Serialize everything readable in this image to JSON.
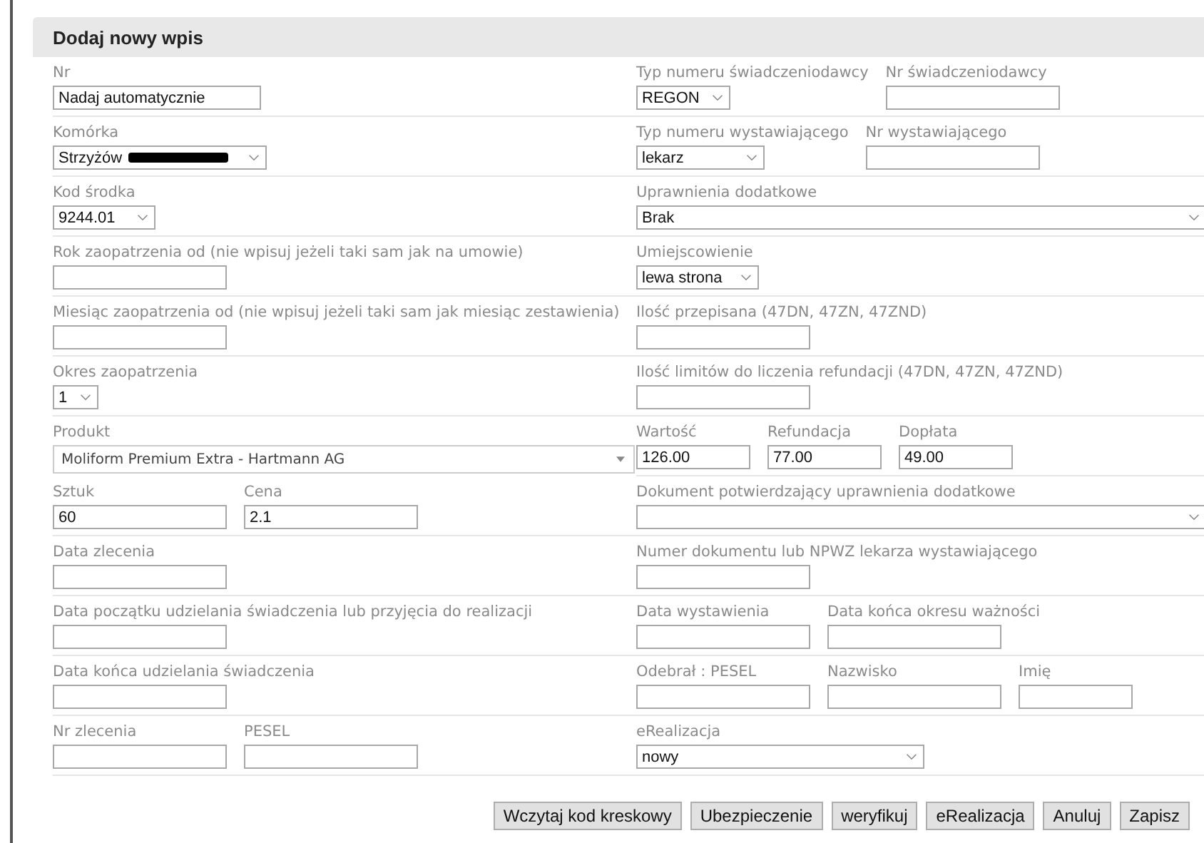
{
  "dialog": {
    "title": "Dodaj nowy wpis"
  },
  "rows": [
    {
      "left": {
        "divider": true,
        "fields": [
          {
            "label": "Nr",
            "kind": "text",
            "value": "Nadaj automatycznie"
          }
        ]
      },
      "right": {
        "divider": true,
        "fields": [
          {
            "label": "Typ numeru świadczeniodawcy",
            "kind": "select",
            "value": "REGON"
          },
          {
            "label": "Nr świadczeniodawcy",
            "kind": "text"
          }
        ]
      }
    },
    {
      "left": {
        "divider": true,
        "fields": [
          {
            "label": "Komórka",
            "kind": "select",
            "value": "Strzyżów",
            "redacted": true
          }
        ]
      },
      "right": {
        "divider": true,
        "fields": [
          {
            "label": "Typ numeru wystawiającego",
            "kind": "select",
            "value": "lekarz"
          },
          {
            "label": "Nr wystawiającego",
            "kind": "text"
          }
        ]
      }
    },
    {
      "left": {
        "divider": true,
        "fields": [
          {
            "label": "Kod środka",
            "kind": "select",
            "value": "9244.01"
          }
        ]
      },
      "right": {
        "divider": true,
        "fields": [
          {
            "label": "Uprawnienia dodatkowe",
            "kind": "select",
            "value": "Brak"
          }
        ]
      }
    },
    {
      "left": {
        "divider": true,
        "fields": [
          {
            "label": "Rok zaopatrzenia od (nie wpisuj jeżeli taki sam jak na umowie)",
            "kind": "text"
          }
        ]
      },
      "right": {
        "divider": true,
        "fields": [
          {
            "label": "Umiejscowienie",
            "kind": "select",
            "value": "lewa strona"
          }
        ]
      }
    },
    {
      "left": {
        "divider": true,
        "fields": [
          {
            "label": "Miesiąc zaopatrzenia od (nie wpisuj jeżeli taki sam jak miesiąc zestawienia)",
            "kind": "text"
          }
        ]
      },
      "right": {
        "divider": true,
        "fields": [
          {
            "label": "Ilość przepisana (47DN, 47ZN, 47ZND)",
            "kind": "text"
          }
        ]
      }
    },
    {
      "left": {
        "divider": true,
        "fields": [
          {
            "label": "Okres zaopatrzenia",
            "kind": "select",
            "value": "1"
          }
        ]
      },
      "right": {
        "divider": true,
        "fields": [
          {
            "label": "Ilość limitów do liczenia refundacji (47DN, 47ZN, 47ZND)",
            "kind": "text"
          }
        ]
      }
    },
    {
      "left": {
        "divider": false,
        "fields": [
          {
            "label": "Produkt",
            "kind": "combo",
            "value": "Moliform Premium Extra - Hartmann AG"
          }
        ]
      },
      "right": {
        "divider": true,
        "fields": [
          {
            "label": "Wartość",
            "kind": "text",
            "value": "126.00"
          },
          {
            "label": "Refundacja",
            "kind": "text",
            "value": "77.00"
          },
          {
            "label": "Dopłata",
            "kind": "text",
            "value": "49.00"
          }
        ]
      }
    },
    {
      "left": {
        "divider": true,
        "fields": [
          {
            "label": "Sztuk",
            "kind": "text",
            "value": "60"
          },
          {
            "label": "Cena",
            "kind": "text",
            "value": "2.1"
          }
        ]
      },
      "right": {
        "divider": true,
        "fields": [
          {
            "label": "Dokument potwierdzający uprawnienia dodatkowe",
            "kind": "select"
          }
        ]
      }
    },
    {
      "left": {
        "divider": true,
        "fields": [
          {
            "label": "Data zlecenia",
            "kind": "text"
          }
        ]
      },
      "right": {
        "divider": true,
        "fields": [
          {
            "label": "Numer dokumentu lub NPWZ lekarza wystawiającego",
            "kind": "text"
          }
        ]
      }
    },
    {
      "left": {
        "divider": true,
        "fields": [
          {
            "label": "Data początku udzielania świadczenia lub przyjęcia do realizacji",
            "kind": "text"
          }
        ]
      },
      "right": {
        "divider": true,
        "fields": [
          {
            "label": "Data wystawienia",
            "kind": "text"
          },
          {
            "label": "Data końca okresu ważności",
            "kind": "text"
          }
        ]
      }
    },
    {
      "left": {
        "divider": true,
        "fields": [
          {
            "label": "Data końca udzielania świadczenia",
            "kind": "text"
          }
        ]
      },
      "right": {
        "divider": true,
        "fields": [
          {
            "label": "Odebrał : PESEL",
            "kind": "text"
          },
          {
            "label": "Nazwisko",
            "kind": "text"
          },
          {
            "label": "Imię",
            "kind": "text"
          }
        ]
      }
    },
    {
      "left": {
        "divider": true,
        "fields": [
          {
            "label": "Nr zlecenia",
            "kind": "text"
          },
          {
            "label": "PESEL",
            "kind": "text"
          }
        ]
      },
      "right": {
        "divider": true,
        "fields": [
          {
            "label": "eRealizacja",
            "kind": "select",
            "value": "nowy"
          }
        ]
      }
    }
  ],
  "buttons": [
    "Wczytaj kod kreskowy",
    "Ubezpieczenie",
    "weryfikuj",
    "eRealizacja",
    "Anuluj",
    "Zapisz"
  ]
}
